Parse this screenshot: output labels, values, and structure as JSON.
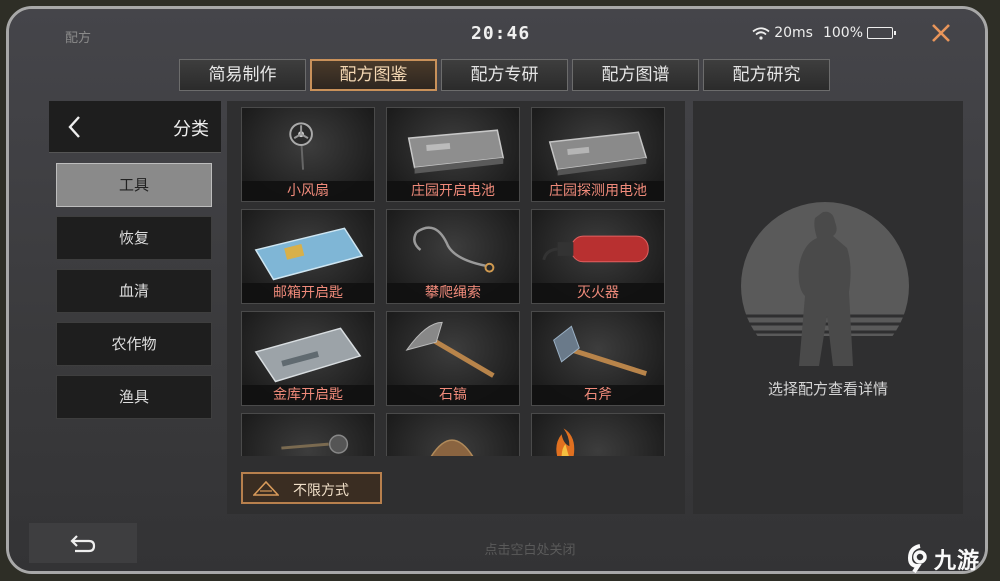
{
  "window": {
    "title": "配方"
  },
  "status": {
    "time": "20:46",
    "ping": "20ms",
    "battery": "100%"
  },
  "tabs": [
    {
      "label": "简易制作",
      "active": false
    },
    {
      "label": "配方图鉴",
      "active": true
    },
    {
      "label": "配方专研",
      "active": false
    },
    {
      "label": "配方图谱",
      "active": false
    },
    {
      "label": "配方研究",
      "active": false
    }
  ],
  "sidebar": {
    "title": "分类",
    "items": [
      {
        "label": "工具",
        "active": true
      },
      {
        "label": "恢复",
        "active": false
      },
      {
        "label": "血清",
        "active": false
      },
      {
        "label": "农作物",
        "active": false
      },
      {
        "label": "渔具",
        "active": false
      }
    ]
  },
  "recipes": [
    {
      "name": "小风扇",
      "icon": "fan-icon"
    },
    {
      "name": "庄园开启电池",
      "icon": "battery-pack-icon"
    },
    {
      "name": "庄园探测用电池",
      "icon": "battery-pack-icon"
    },
    {
      "name": "邮箱开启匙",
      "icon": "keycard-icon"
    },
    {
      "name": "攀爬绳索",
      "icon": "grappling-hook-icon"
    },
    {
      "name": "灭火器",
      "icon": "extinguisher-icon"
    },
    {
      "name": "金库开启匙",
      "icon": "keycard-icon"
    },
    {
      "name": "石镐",
      "icon": "pickaxe-icon"
    },
    {
      "name": "石斧",
      "icon": "axe-icon"
    },
    {
      "name": "",
      "icon": "pan-icon"
    },
    {
      "name": "",
      "icon": "basket-icon"
    },
    {
      "name": "",
      "icon": "campfire-icon"
    }
  ],
  "filter": {
    "label": "不限方式"
  },
  "detail": {
    "hint": "选择配方查看详情"
  },
  "footer": {
    "close_hint": "点击空白处关闭"
  },
  "watermark": {
    "text": "九游"
  },
  "colors": {
    "accent": "#c9915a",
    "item_label": "#ef8a7a",
    "close": "#e8955a"
  }
}
